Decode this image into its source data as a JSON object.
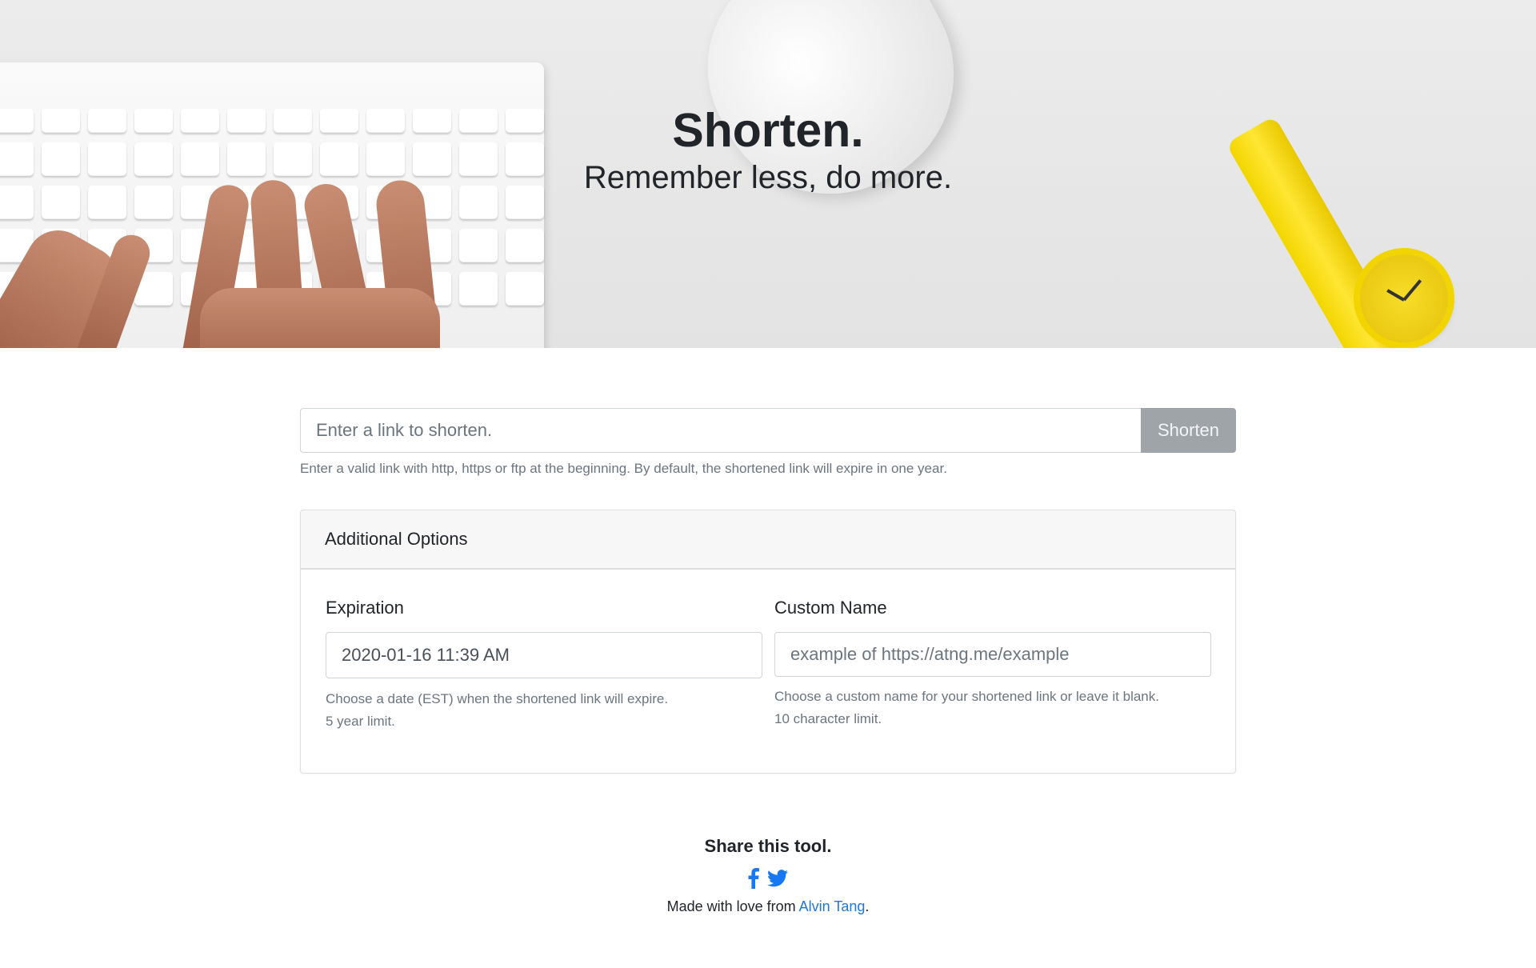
{
  "hero": {
    "title": "Shorten.",
    "subtitle": "Remember less, do more."
  },
  "shorten_form": {
    "url_placeholder": "Enter a link to shorten.",
    "button_label": "Shorten",
    "help_text": "Enter a valid link with http, https or ftp at the beginning. By default, the shortened link will expire in one year."
  },
  "options": {
    "header": "Additional Options",
    "expiration": {
      "label": "Expiration",
      "value": "2020-01-16 11:39 AM",
      "help_line1": "Choose a date (EST) when the shortened link will expire.",
      "help_line2": "5 year limit."
    },
    "custom_name": {
      "label": "Custom Name",
      "placeholder": "example of https://atng.me/example",
      "help_line1": "Choose a custom name for your shortened link or leave it blank.",
      "help_line2": "10 character limit."
    }
  },
  "footer": {
    "share_title": "Share this tool.",
    "social_icons": [
      "facebook-icon",
      "twitter-icon"
    ],
    "made_with_prefix": "Made with love from ",
    "author_link": "Alvin Tang",
    "made_with_suffix": "."
  },
  "colors": {
    "link": "#1e78d7",
    "button_bg": "#9fa4a9",
    "social_icon": "#1877f2"
  }
}
